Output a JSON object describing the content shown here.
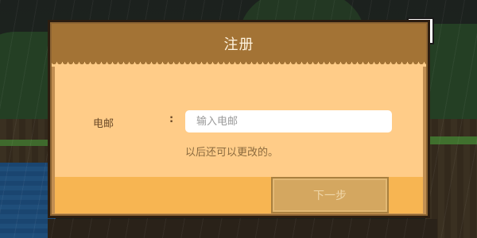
{
  "dialog": {
    "title": "注册",
    "email_label": "电邮",
    "colon": ":",
    "email_placeholder": "输入电邮",
    "email_value": "",
    "hint": "以后还可以更改的。",
    "next_label": "下一步"
  },
  "controls": {
    "back_icon": "back-arrow-icon"
  }
}
